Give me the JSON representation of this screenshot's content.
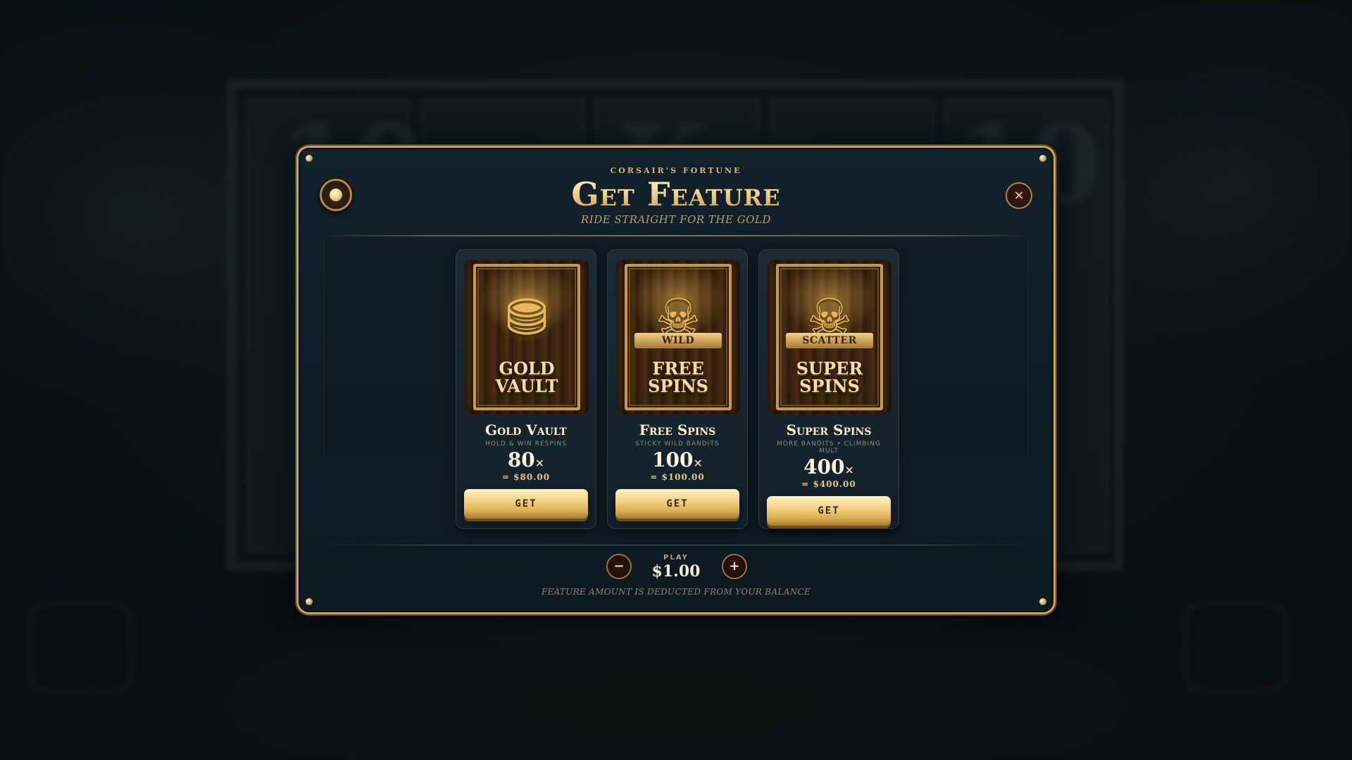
{
  "game": {
    "name": "Corsair's Fortune"
  },
  "modal": {
    "title": "Get Feature",
    "tagline": "Ride straight for the gold",
    "close_symbol": "×"
  },
  "features": [
    {
      "id": "gold-vault",
      "art_label_line1": "Gold",
      "art_label_line2": "Vault",
      "art_icon": "treasure-chest-icon",
      "art_glyph": "⛃",
      "art_banner": "",
      "title": "Gold Vault",
      "description": "Hold & Win Respins",
      "multiplier": "80",
      "multiplier_suffix": "×",
      "price": "= $80.00",
      "button": "GET"
    },
    {
      "id": "free-spins",
      "art_label_line1": "Free",
      "art_label_line2": "Spins",
      "art_icon": "pirate-captain-icon",
      "art_glyph": "☠",
      "art_banner": "WILD",
      "title": "Free Spins",
      "description": "Sticky Wild Bandits",
      "multiplier": "100",
      "multiplier_suffix": "×",
      "price": "= $100.00",
      "button": "GET"
    },
    {
      "id": "super-spins",
      "art_label_line1": "Super",
      "art_label_line2": "Spins",
      "art_icon": "skull-barrel-icon",
      "art_glyph": "☠",
      "art_banner": "SCATTER",
      "title": "Super Spins",
      "description": "More Bandits • Climbing Mult",
      "multiplier": "400",
      "multiplier_suffix": "×",
      "price": "= $400.00",
      "button": "GET"
    }
  ],
  "bet": {
    "label": "PLAY",
    "value": "$1.00",
    "decrease_symbol": "−",
    "increase_symbol": "+"
  },
  "footnote": "Feature amount is deducted from your balance",
  "colors": {
    "gold_accent": "#c9a45c",
    "modal_bg": "#12212b",
    "button_gold": "#f0cf7b"
  }
}
